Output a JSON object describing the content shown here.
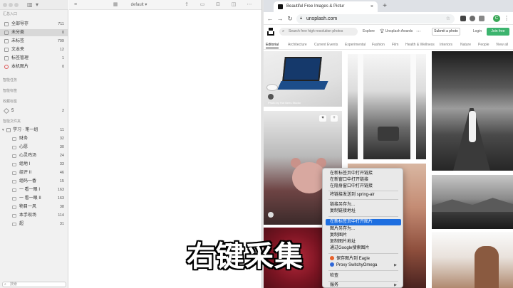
{
  "sidebar": {
    "sections": {
      "inbox": "汇总入口",
      "smart": "智能任务",
      "tags": "智能标签",
      "favorites": "收藏标签",
      "folders": "智能文件夹"
    },
    "inbox_items": [
      {
        "label": "全部导存",
        "count": "711"
      },
      {
        "label": "未分类",
        "count": "0"
      },
      {
        "label": "未标签",
        "count": "709"
      },
      {
        "label": "文本夹",
        "count": "12"
      },
      {
        "label": "标签管理",
        "count": "1"
      },
      {
        "label": "本机图片",
        "count": "0"
      }
    ],
    "favorite_item": {
      "label": "5",
      "count": "2"
    },
    "folders_parent": {
      "label": "学习 · 笔一组",
      "count": "11"
    },
    "folders": [
      {
        "label": "财务",
        "count": "32"
      },
      {
        "label": "心愿",
        "count": "30"
      },
      {
        "label": "心灵鸡汤",
        "count": "24"
      },
      {
        "label": "组地 I",
        "count": "33"
      },
      {
        "label": "组评 II",
        "count": "46"
      },
      {
        "label": "组码一香",
        "count": "15"
      },
      {
        "label": "一 看一眼 I",
        "count": "163"
      },
      {
        "label": "一 看一眼 II",
        "count": "163"
      },
      {
        "label": "物目一风",
        "count": "38"
      },
      {
        "label": "本手现场",
        "count": "114"
      },
      {
        "label": "超",
        "count": "31"
      }
    ],
    "search_placeholder": "搜索"
  },
  "editor": {
    "title": "default",
    "toolbar_icons": [
      "sidebar-toggle-icon",
      "grid-icon",
      "share-icon",
      "layout-icon",
      "panel-icon"
    ]
  },
  "browser": {
    "tab_title": "Beautiful Free Images & Pictur",
    "url": "unsplash.com",
    "avatar_letter": "C",
    "unsplash": {
      "search_placeholder": "Search free high-resolution photos",
      "explore": "Explore",
      "awards": "Unsplash Awards",
      "submit": "Submit a photo",
      "login": "Login",
      "join": "Join free",
      "categories": [
        "Editorial",
        "Architecture",
        "Current Events",
        "Experimental",
        "Fashion",
        "Film",
        "Health & Wellness",
        "Interiors",
        "Nature",
        "People",
        "View all"
      ],
      "photo1_caption": "Photo by Hot Bees Studio"
    }
  },
  "context_menu": {
    "items": [
      "在新标签页中打开链接",
      "在新窗口中打开链接",
      "在隐身窗口中打开链接",
      "将链接发送到 spring-air",
      "链接另存为...",
      "复制链接地址",
      "在新标签页中打开图片",
      "图片另存为...",
      "复制图片",
      "复制图片地址",
      "通过Google搜索图片",
      "保存图片到 Eagle",
      "Proxy SwitchyOmega",
      "检查",
      "服务"
    ],
    "highlighted_index": 6
  },
  "overlay_caption": "右键采集",
  "colors": {
    "accent_blue": "#1d6ee0",
    "join_green": "#3cb46e",
    "avatar_green": "#3aa757"
  }
}
